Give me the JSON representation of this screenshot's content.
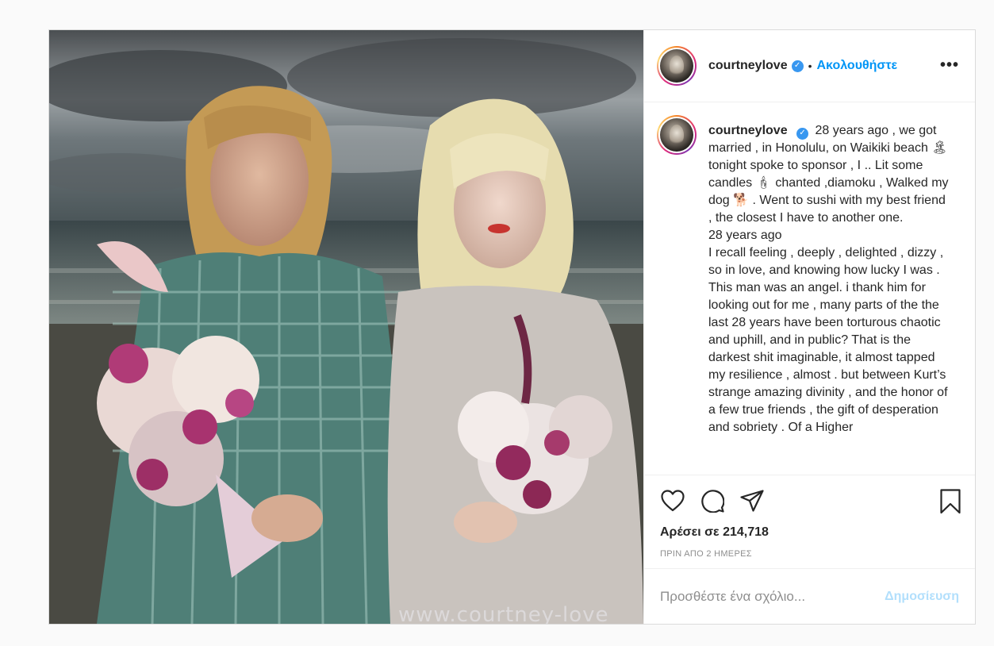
{
  "photo": {
    "watermark": "www.courtney-love",
    "alt": "Wedding photo on the beach"
  },
  "header": {
    "username": "courtneylove",
    "verified_symbol": "✓",
    "separator": "•",
    "follow_label": "Ακολουθήστε",
    "more_label": "•••"
  },
  "caption": {
    "username": "courtneylove",
    "verified_symbol": "✓",
    "text": "28 years ago , we got married , in Honolulu, on Waikiki beach 🏝 tonight spoke to sponsor , I .. Lit some candles 🕯 chanted ,diamoku , Walked my dog 🐕 . Went to sushi with my best friend , the closest I have to another one.",
    "text2": "28 years ago",
    "text3": "I recall feeling , deeply , delighted , dizzy , so in love, and knowing how lucky I was . This man was an angel. i thank him for looking out for me , many parts of the the last 28 years have been torturous chaotic and uphill, and in public? That is the darkest shit imaginable, it almost tapped my resilience , almost . but between Kurt’s strange amazing divinity , and the honor of a few true friends , the gift of desperation and sobriety . Of a Higher"
  },
  "actions": {
    "icons": [
      "heart-icon",
      "comment-icon",
      "share-icon",
      "bookmark-icon"
    ],
    "likes": "Αρέσει σε 214,718",
    "time": "ΠΡΙΝ ΑΠΟ 2 ΗΜΕΡΕΣ"
  },
  "comment_box": {
    "placeholder": "Προσθέστε ένα σχόλιο...",
    "post_label": "Δημοσίευση"
  },
  "colors": {
    "link_blue": "#0095f6",
    "post_disabled": "#b2dffc",
    "verified": "#3897f0",
    "muted": "#8e8e8e"
  }
}
